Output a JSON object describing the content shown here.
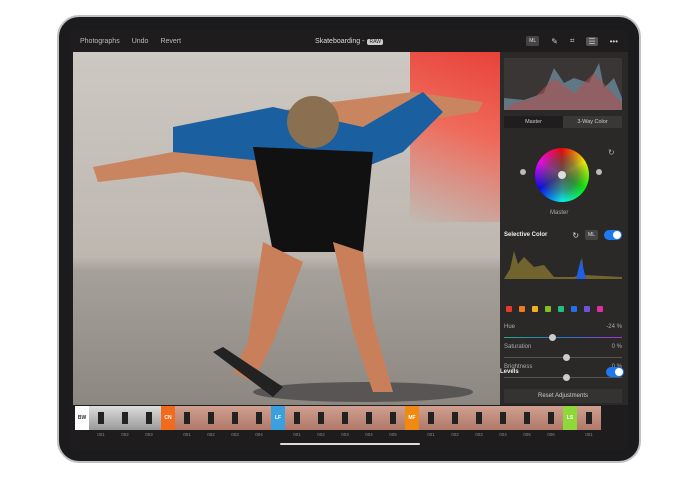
{
  "topbar": {
    "photographs": "Photographs",
    "undo": "Undo",
    "revert": "Revert",
    "title": "Skateboarding -",
    "raw_badge": "RAW",
    "ml": "ML"
  },
  "panel": {
    "tabs": [
      "Master",
      "3-Way Color"
    ],
    "wheel_label": "Master",
    "selective_color": {
      "title": "Selective Color",
      "ml": "ML",
      "enabled": true,
      "swatches": [
        "#e53a2a",
        "#f07a20",
        "#f0b020",
        "#80c020",
        "#20c080",
        "#2070f0",
        "#7050e0",
        "#e030a0"
      ],
      "hue_label": "Hue",
      "hue_value": "-24 %",
      "hue": -24,
      "saturation_label": "Saturation",
      "saturation_value": "0 %",
      "saturation": 0,
      "brightness_label": "Brightness",
      "brightness_value": "0 %",
      "brightness": 0
    },
    "levels": {
      "title": "Levels",
      "enabled": true
    },
    "reset": "Reset Adjustments"
  },
  "filmstrip": [
    {
      "tag": "BW",
      "color": "#ffffff",
      "text": "#333",
      "bw": true,
      "items": [
        "001",
        "002",
        "003"
      ]
    },
    {
      "tag": "CN",
      "color": "#f26a1b",
      "text": "#fff",
      "items": [
        "001",
        "002",
        "003",
        "004"
      ]
    },
    {
      "tag": "LF",
      "color": "#3aa0e0",
      "text": "#fff",
      "items": [
        "001",
        "002",
        "003",
        "004",
        "005"
      ]
    },
    {
      "tag": "MF",
      "color": "#f08a10",
      "text": "#fff",
      "items": [
        "001",
        "002",
        "003",
        "004",
        "005",
        "006"
      ]
    },
    {
      "tag": "LS",
      "color": "#8fd83a",
      "text": "#fff",
      "items": [
        "001"
      ]
    }
  ]
}
